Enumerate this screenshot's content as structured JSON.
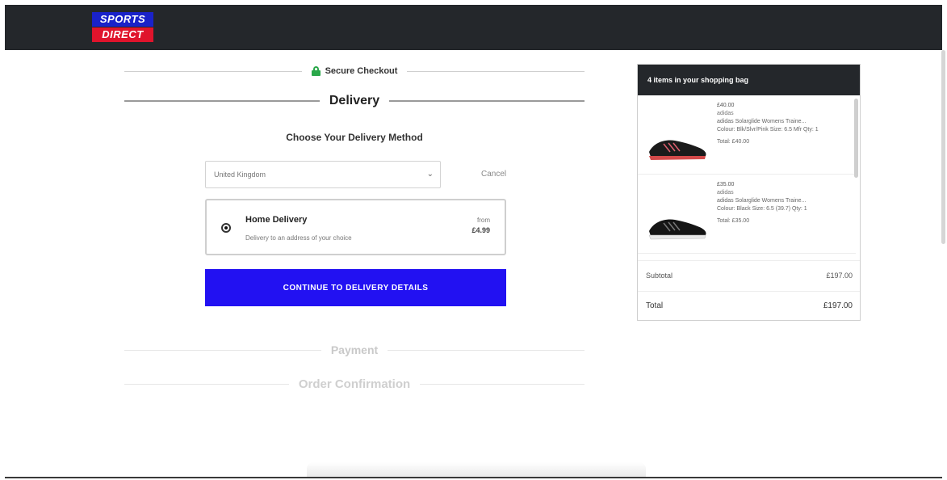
{
  "brand": {
    "line1": "SPORTS",
    "line2": "DIRECT"
  },
  "checkout": {
    "secure_label": "Secure Checkout",
    "delivery_heading": "Delivery",
    "choose_title": "Choose Your Delivery Method",
    "country_value": "United Kingdom",
    "cancel_label": "Cancel",
    "option": {
      "title": "Home Delivery",
      "subtitle": "Delivery to an address of your choice",
      "from_label": "from",
      "price": "£4.99"
    },
    "continue_label": "CONTINUE TO DELIVERY DETAILS",
    "payment_heading": "Payment",
    "confirmation_heading": "Order Confirmation"
  },
  "bag": {
    "header": "4 items in your shopping bag",
    "items": [
      {
        "price": "£40.00",
        "brand": "adidas",
        "name": "adidas Solarglide Womens Traine...",
        "details": "Colour: Blk/Slvr/Pink Size: 6.5 Mfr Qty: 1",
        "total": "Total: £40.00"
      },
      {
        "price": "£35.00",
        "brand": "adidas",
        "name": "adidas Solarglide Womens Traine...",
        "details": "Colour: Black Size: 6.5 (39.7) Qty: 1",
        "total": "Total: £35.00"
      }
    ],
    "subtotal_label": "Subtotal",
    "subtotal_value": "£197.00",
    "total_label": "Total",
    "total_value": "£197.00"
  },
  "colors": {
    "header_bg": "#24272b",
    "accent_button": "#2211f2",
    "logo_blue": "#1a22c9",
    "logo_red": "#e0142c",
    "secure_green": "#2aa84a"
  },
  "icons": {
    "lock": "lock-icon",
    "dropdown": "chevron-down-icon",
    "radio": "radio-selected-icon"
  }
}
